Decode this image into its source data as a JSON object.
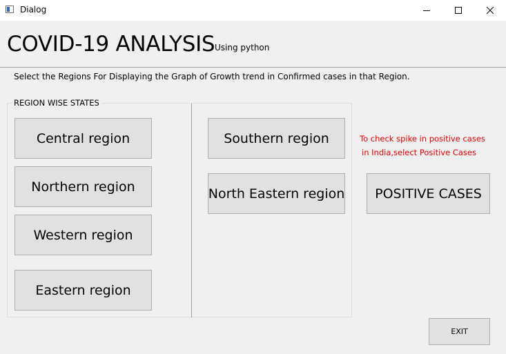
{
  "window": {
    "title": "Dialog",
    "app_icon": "dialog-app-icon",
    "controls": {
      "minimize_icon": "minimize-icon",
      "maximize_icon": "maximize-icon",
      "close_icon": "close-icon"
    }
  },
  "header": {
    "title": "COVID-19 ANALYSIS",
    "subtitle": "Using python"
  },
  "instruction": "Select the Regions For Displaying the Graph of Growth trend in Confirmed cases in that Region.",
  "region_group": {
    "title": "REGION WISE STATES",
    "buttons": {
      "central": "Central region",
      "northern": "Northern region",
      "western": "Western region",
      "eastern": "Eastern region",
      "southern": "Southern region",
      "north_eastern": "North Eastern region"
    }
  },
  "positive": {
    "note_line1": "To check spike in positive cases",
    "note_line2": "in India,select Positive Cases",
    "button": "POSITIVE CASES"
  },
  "exit_button": "EXIT",
  "colors": {
    "background": "#f0f0f0",
    "button_face": "#e1e1e1",
    "button_border": "#adadad",
    "note_text": "#e00000"
  }
}
